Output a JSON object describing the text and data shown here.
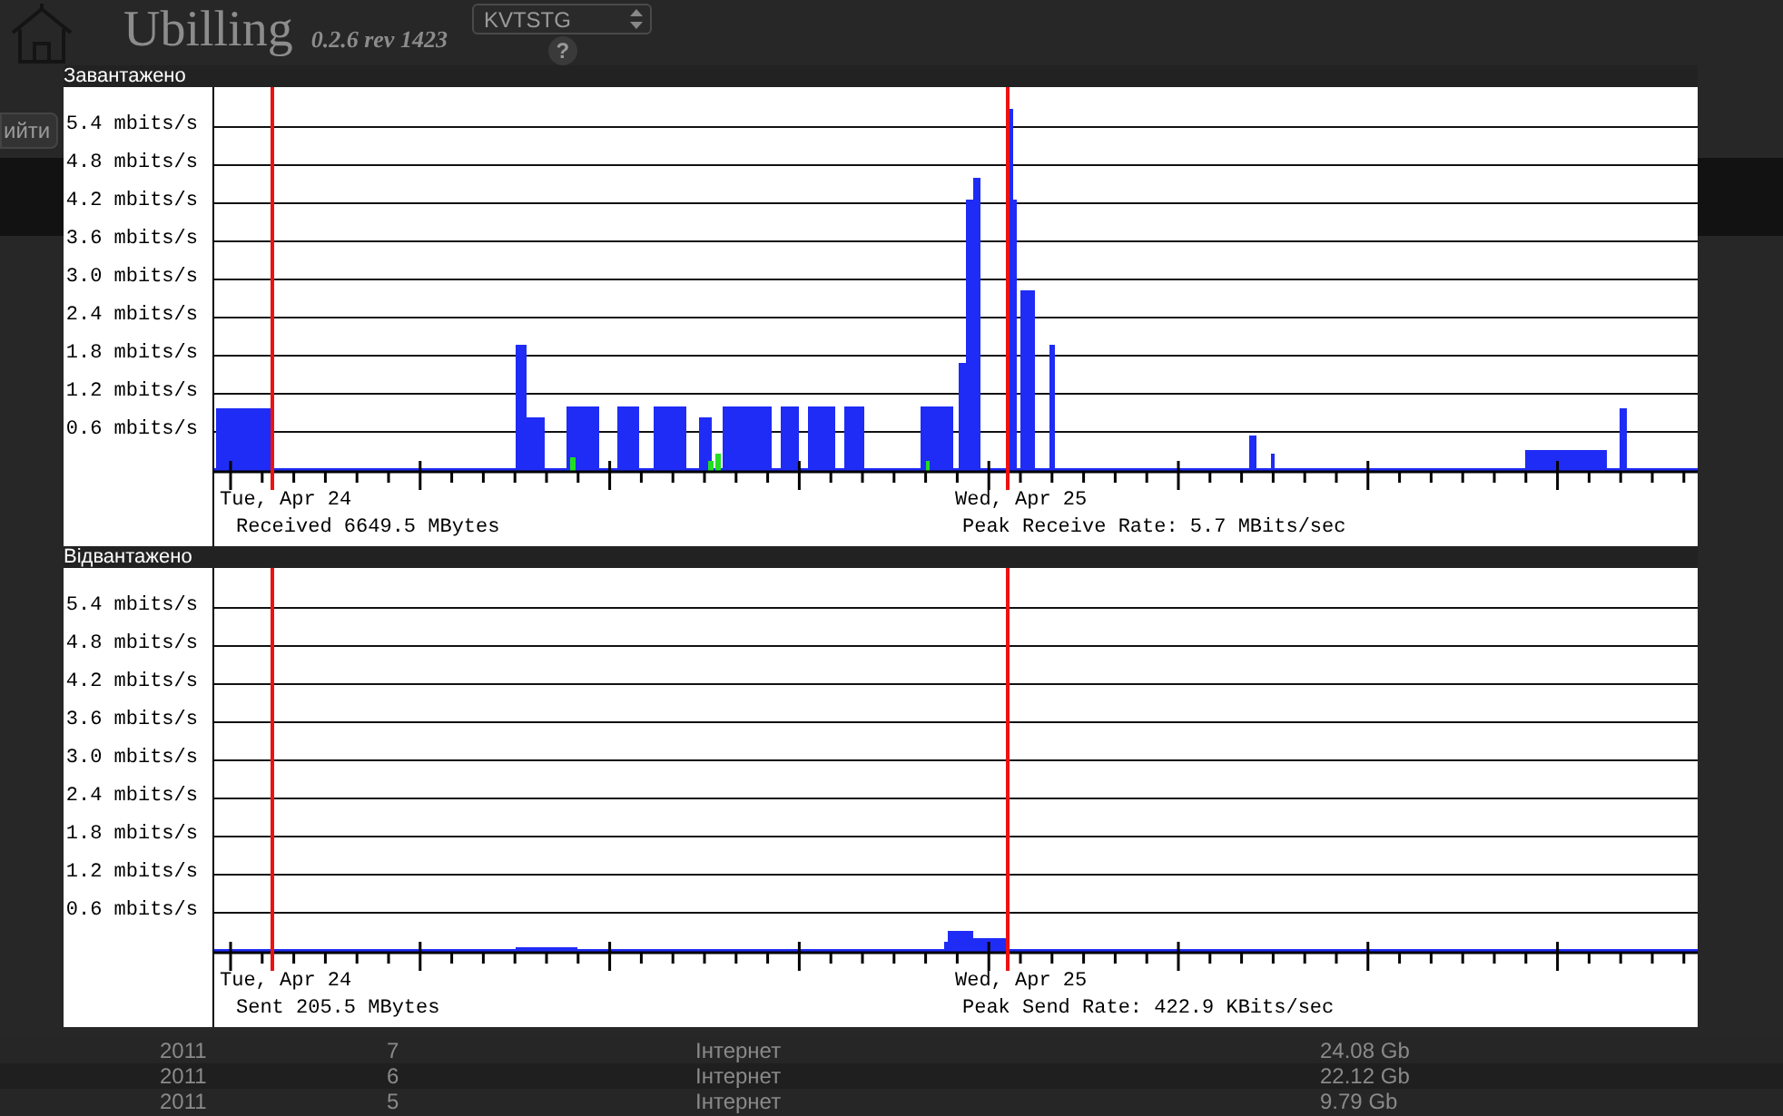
{
  "header": {
    "logo": "Ubilling",
    "version": "0.2.6 rev 1423",
    "location_select": "KVTSTG",
    "help": "?",
    "logout_button": "ийти"
  },
  "table_rows": [
    {
      "year": "2011",
      "month": "7",
      "traffic_class": "Інтернет",
      "downloaded": "24.08 Gb"
    },
    {
      "year": "2011",
      "month": "6",
      "traffic_class": "Інтернет",
      "downloaded": "22.12 Gb"
    },
    {
      "year": "2011",
      "month": "5",
      "traffic_class": "Інтернет",
      "downloaded": "9.79 Gb"
    }
  ],
  "graphs": [
    {
      "kind": "receive",
      "title": "Завантажено",
      "y_labels": [
        "5.4 mbits/s",
        "4.8 mbits/s",
        "4.2 mbits/s",
        "3.6 mbits/s",
        "3.0 mbits/s",
        "2.4 mbits/s",
        "1.8 mbits/s",
        "1.2 mbits/s",
        "0.6 mbits/s"
      ],
      "x_labels": [
        "Tue, Apr 24",
        "Wed, Apr 25"
      ],
      "total": "Received 6649.5 MBytes",
      "peak": "Peak Receive Rate: 5.7 MBits/sec"
    },
    {
      "kind": "send",
      "title": "Відвантажено",
      "y_labels": [
        "5.4 mbits/s",
        "4.8 mbits/s",
        "4.2 mbits/s",
        "3.6 mbits/s",
        "3.0 mbits/s",
        "2.4 mbits/s",
        "1.8 mbits/s",
        "1.2 mbits/s",
        "0.6 mbits/s"
      ],
      "x_labels": [
        "Tue, Apr 24",
        "Wed, Apr 25"
      ],
      "total": "Sent 205.5 MBytes",
      "peak": "Peak Send Rate: 422.9 KBits/sec"
    }
  ]
}
